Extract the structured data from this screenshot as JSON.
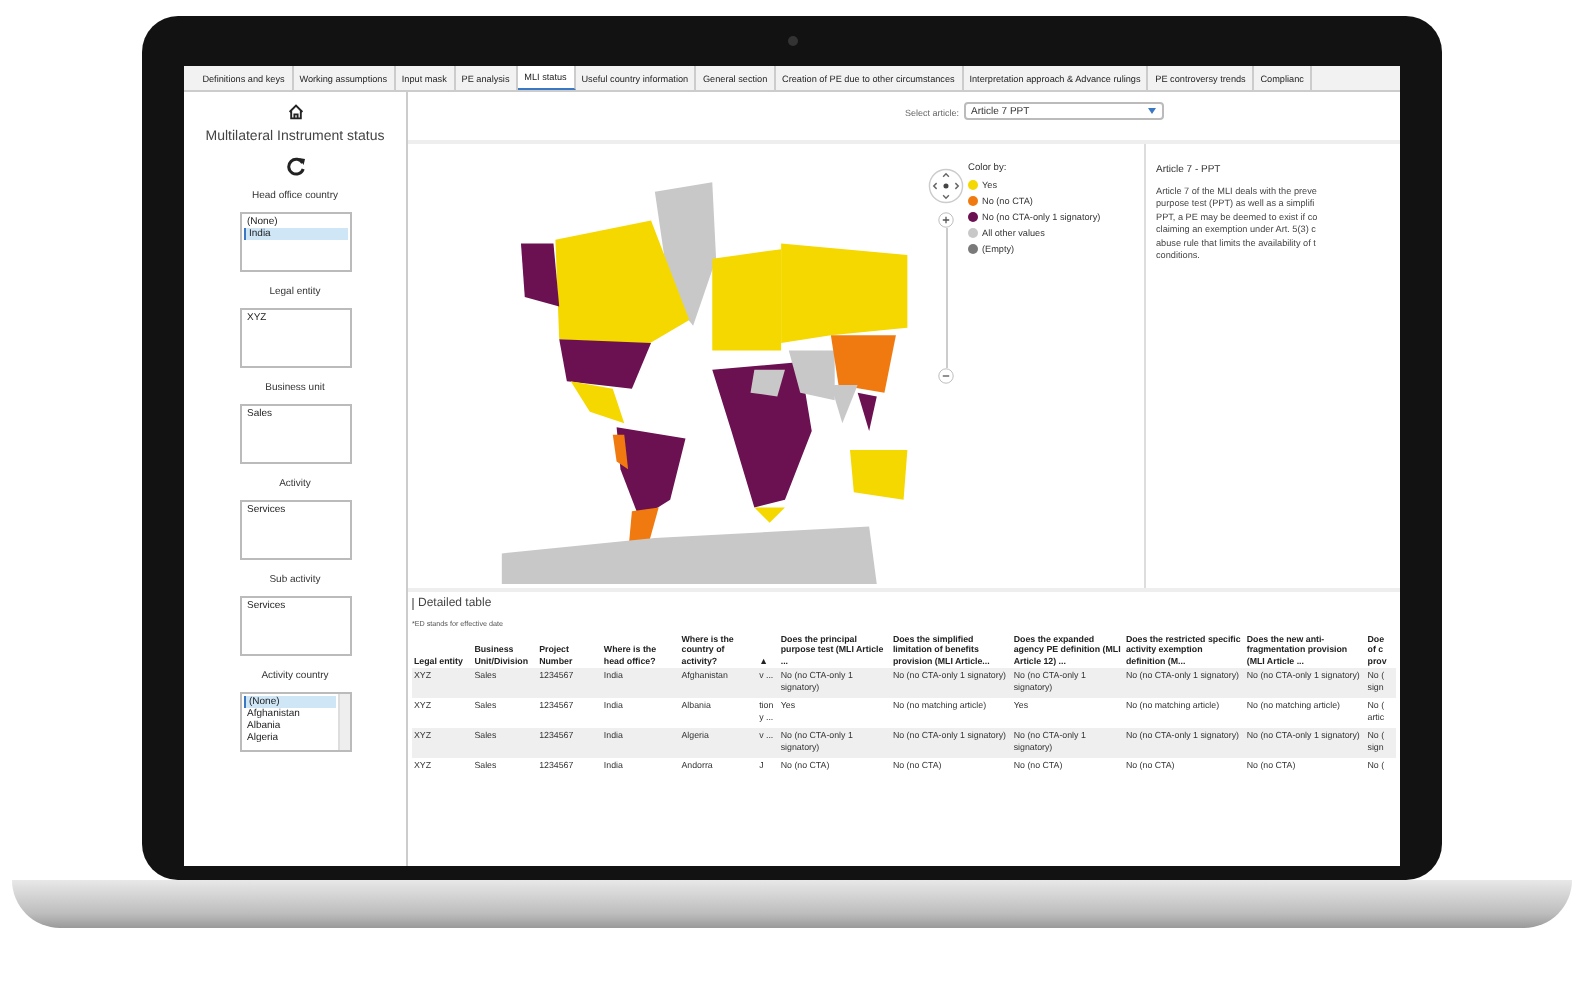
{
  "tabs": [
    {
      "label": "Definitions and keys",
      "selected": false
    },
    {
      "label": "Working assumptions",
      "selected": false
    },
    {
      "label": "Input mask",
      "selected": false
    },
    {
      "label": "PE analysis",
      "selected": false
    },
    {
      "label": "MLI status",
      "selected": true
    },
    {
      "label": "Useful country information",
      "selected": false
    },
    {
      "label": "General section",
      "selected": false
    },
    {
      "label": "Creation of PE due to other circumstances",
      "selected": false
    },
    {
      "label": "Interpretation approach & Advance rulings",
      "selected": false
    },
    {
      "label": "PE controversy trends",
      "selected": false
    },
    {
      "label": "Complianc",
      "selected": false
    }
  ],
  "sidebar": {
    "title": "Multilateral Instrument status",
    "filters": [
      {
        "label": "Head office country",
        "items": [
          {
            "text": "(None)",
            "selected": false
          },
          {
            "text": "India",
            "selected": true
          }
        ]
      },
      {
        "label": "Legal entity",
        "items": [
          {
            "text": "XYZ",
            "selected": false
          }
        ]
      },
      {
        "label": "Business unit",
        "items": [
          {
            "text": "Sales",
            "selected": false
          }
        ]
      },
      {
        "label": "Activity",
        "items": [
          {
            "text": "Services",
            "selected": false
          }
        ]
      },
      {
        "label": "Sub activity",
        "items": [
          {
            "text": "Services",
            "selected": false
          }
        ]
      },
      {
        "label": "Activity country",
        "items": [
          {
            "text": "(None)",
            "selected": true
          },
          {
            "text": "Afghanistan",
            "selected": false
          },
          {
            "text": "Albania",
            "selected": false
          },
          {
            "text": "Algeria",
            "selected": false
          }
        ]
      }
    ]
  },
  "article_select": {
    "label": "Select article:",
    "value": "Article 7 PPT"
  },
  "map": {
    "legend_title": "Color by:",
    "legend": [
      {
        "label": "Yes",
        "color": "#f5d800"
      },
      {
        "label": "No (no CTA)",
        "color": "#f07a10"
      },
      {
        "label": "No (no CTA-only 1 signatory)",
        "color": "#6b1050"
      },
      {
        "label": "All other values",
        "color": "#c8c8c8"
      },
      {
        "label": "(Empty)",
        "color": "#7a7a7a"
      }
    ]
  },
  "article_panel": {
    "title": "Article 7 - PPT",
    "lines": [
      "Article 7 of the MLI deals with the preve",
      "purpose test (PPT) as well as a simplifi",
      "PPT, a PE may be deemed to exist if co",
      "claiming an exemption under Art. 5(3) c",
      "abuse rule that limits the availability of t",
      "conditions."
    ]
  },
  "table": {
    "title": "Detailed table",
    "note": "*ED stands for effective date",
    "columns": [
      "Legal entity",
      "Business Unit/Division",
      "Project Number",
      "Where is the head office?",
      "Where is the country of activity?",
      "▲",
      "Does the principal purpose test (MLI Article ...",
      "Does the simplified limitation of benefits provision (MLI Article...",
      "Does the expanded agency PE definition (MLI Article 12) ...",
      "Does the restricted specific activity exemption definition (M...",
      "Does the new anti-fragmentation provision (MLI Article ...",
      "Doe of c prov"
    ],
    "rows": [
      [
        "XYZ",
        "Sales",
        "1234567",
        "India",
        "Afghanistan",
        "v ...",
        "No (no CTA-only 1 signatory)",
        "No (no CTA-only 1 signatory)",
        "No (no CTA-only 1 signatory)",
        "No (no CTA-only 1 signatory)",
        "No (no CTA-only 1 signatory)",
        "No ( sign"
      ],
      [
        "XYZ",
        "Sales",
        "1234567",
        "India",
        "Albania",
        "tion y ...",
        "Yes",
        "No (no matching article)",
        "Yes",
        "No (no matching article)",
        "No (no matching article)",
        "No ( artic"
      ],
      [
        "XYZ",
        "Sales",
        "1234567",
        "India",
        "Algeria",
        "v ...",
        "No (no CTA-only 1 signatory)",
        "No (no CTA-only 1 signatory)",
        "No (no CTA-only 1 signatory)",
        "No (no CTA-only 1 signatory)",
        "No (no CTA-only 1 signatory)",
        "No ( sign"
      ],
      [
        "XYZ",
        "Sales",
        "1234567",
        "India",
        "Andorra",
        "J",
        "No (no CTA)",
        "No (no CTA)",
        "No (no CTA)",
        "No (no CTA)",
        "No (no CTA)",
        "No ("
      ]
    ]
  }
}
